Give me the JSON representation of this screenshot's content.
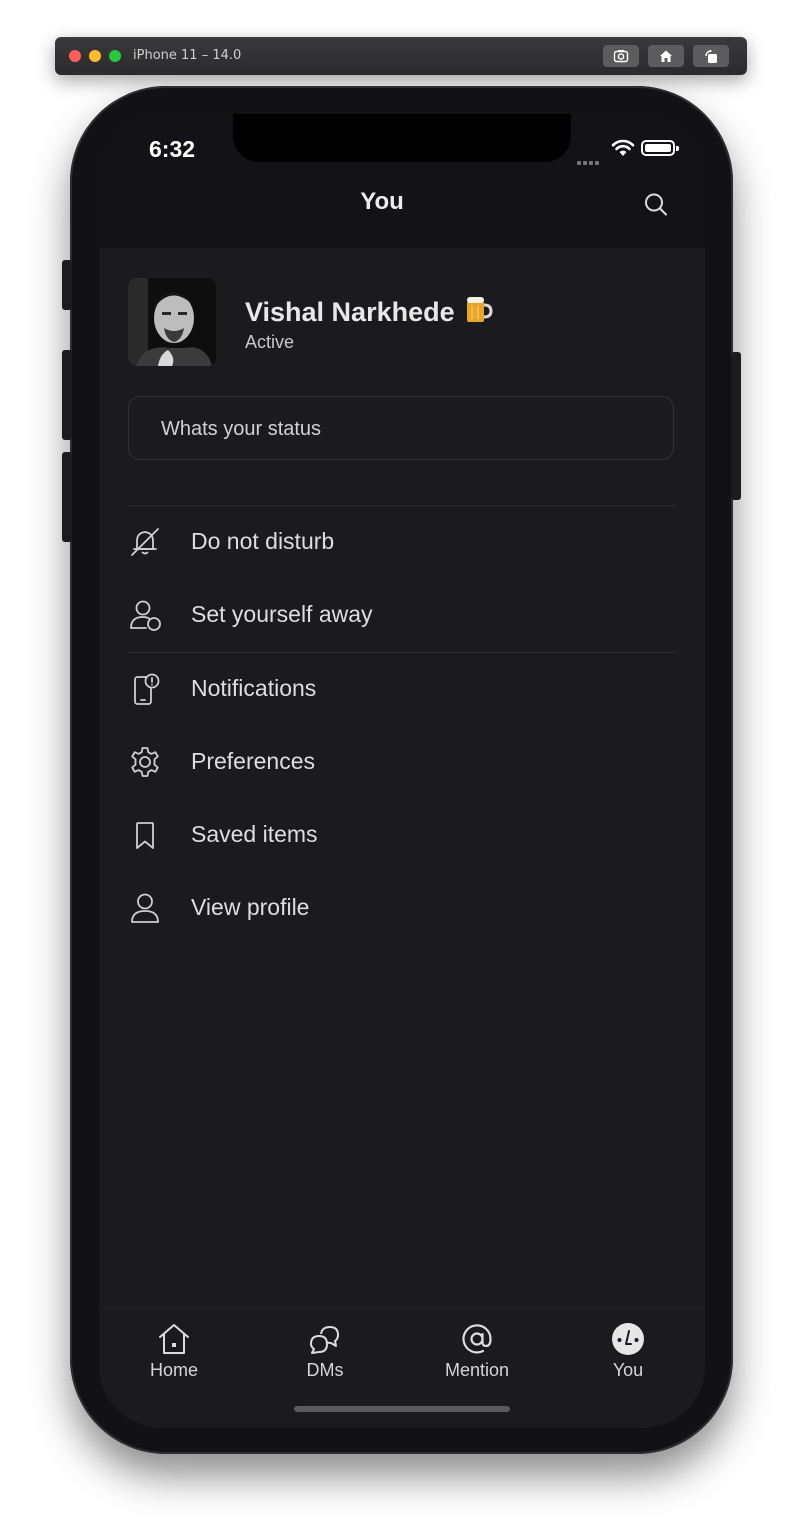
{
  "simulator": {
    "title": "iPhone 11 – 14.0",
    "buttons": [
      "screenshot-icon",
      "home-icon",
      "rotate-icon"
    ]
  },
  "status_bar": {
    "time": "6:32"
  },
  "nav": {
    "title": "You",
    "search_icon": "search-icon"
  },
  "profile": {
    "name": "Vishal Narkhede",
    "emoji": "beer-mug-icon",
    "status": "Active"
  },
  "status_input": {
    "placeholder": "Whats your status"
  },
  "menu": {
    "items": [
      {
        "label": "Do not disturb",
        "icon": "bell-slash-icon"
      },
      {
        "label": "Set yourself away",
        "icon": "user-away-icon"
      },
      {
        "label": "Notifications",
        "icon": "phone-notification-icon"
      },
      {
        "label": "Preferences",
        "icon": "gear-icon"
      },
      {
        "label": "Saved items",
        "icon": "bookmark-icon"
      },
      {
        "label": "View profile",
        "icon": "user-icon"
      }
    ]
  },
  "tabs": [
    {
      "label": "Home",
      "icon": "home-icon"
    },
    {
      "label": "DMs",
      "icon": "chat-bubbles-icon"
    },
    {
      "label": "Mention",
      "icon": "at-icon"
    },
    {
      "label": "You",
      "icon": "you-avatar-icon",
      "active": true
    }
  ],
  "colors": {
    "screen_bg": "#1b1a1e",
    "header_bg": "#131216",
    "text": "#dedede"
  }
}
